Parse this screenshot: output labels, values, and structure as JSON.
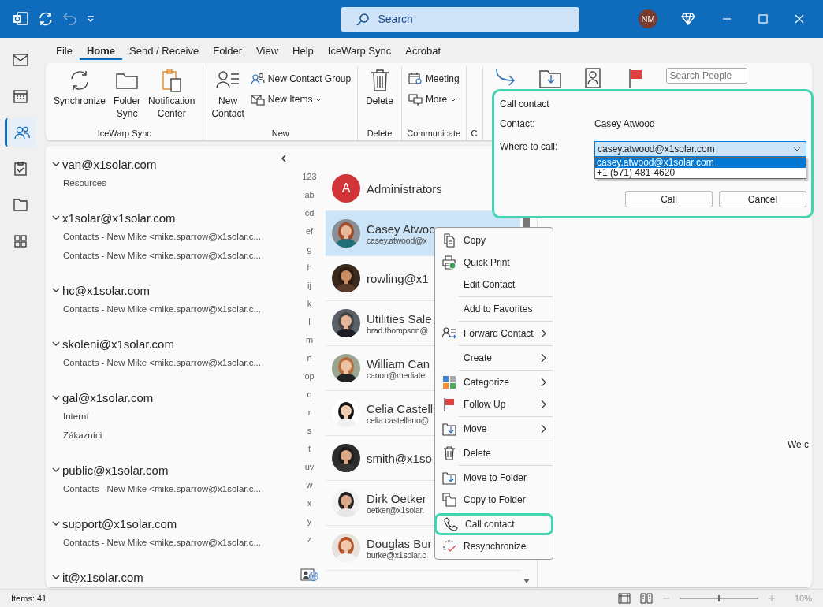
{
  "title_bar": {
    "search": {
      "placeholder": "Search"
    },
    "avatar": "NM",
    "undo": {
      "disabled": true
    }
  },
  "nav_rail": [
    {
      "selected": false
    },
    {
      "selected": false
    },
    {
      "selected": true
    },
    {
      "selected": false
    },
    {
      "selected": false
    },
    {
      "selected": false
    }
  ],
  "ribbon_tabs": [
    {
      "label": "File",
      "selected": false
    },
    {
      "label": "Home",
      "selected": true
    },
    {
      "label": "Send / Receive",
      "selected": false
    },
    {
      "label": "Folder",
      "selected": false
    },
    {
      "label": "View",
      "selected": false
    },
    {
      "label": "Help",
      "selected": false
    },
    {
      "label": "IceWarp Sync",
      "selected": false
    },
    {
      "label": "Acrobat",
      "selected": false
    }
  ],
  "ribbon": {
    "groups": [
      {
        "label": "IceWarp Sync",
        "buttons": [
          {
            "kind": "large",
            "label": "Synchronize"
          },
          {
            "kind": "large",
            "label": "Folder Sync"
          },
          {
            "kind": "large",
            "label": "Notification Center"
          }
        ]
      },
      {
        "label": "New",
        "buttons": [
          {
            "kind": "large",
            "label": "New Contact"
          },
          {
            "kind": "small",
            "label": "New Contact Group",
            "dropdown": false
          },
          {
            "kind": "small",
            "label": "New Items",
            "dropdown": true
          }
        ]
      },
      {
        "label": "Delete",
        "buttons": [
          {
            "kind": "large",
            "label": "Delete"
          }
        ]
      },
      {
        "label": "Communicate",
        "buttons": [
          {
            "kind": "small",
            "label": "Meeting",
            "dropdown": false
          },
          {
            "kind": "small",
            "label": "More",
            "dropdown": true
          }
        ]
      },
      {
        "label": "C"
      }
    ],
    "search_people": {
      "placeholder": "Search People"
    }
  },
  "folders": [
    {
      "name": "van@x1solar.com",
      "expanded": true,
      "children": [
        {
          "name": "Resources"
        }
      ]
    },
    {
      "name": "x1solar@x1solar.com",
      "expanded": true,
      "children": [
        {
          "name": "Contacts - New Mike <mike.sparrow@x1solar.c..."
        },
        {
          "name": "Contacts - New Mike <mike.sparrow@x1solar.c..."
        }
      ]
    },
    {
      "name": "hc@x1solar.com",
      "expanded": true,
      "children": [
        {
          "name": "Contacts - New Mike <mike.sparrow@x1solar.c..."
        }
      ]
    },
    {
      "name": "skoleni@x1solar.com",
      "expanded": true,
      "children": [
        {
          "name": "Contacts - New Mike <mike.sparrow@x1solar.c..."
        }
      ]
    },
    {
      "name": "gal@x1solar.com",
      "expanded": true,
      "children": [
        {
          "name": "Interní"
        },
        {
          "name": "Zákazníci"
        }
      ]
    },
    {
      "name": "public@x1solar.com",
      "expanded": true,
      "children": [
        {
          "name": "Contacts - New Mike <mike.sparrow@x1solar.c..."
        }
      ]
    },
    {
      "name": "support@x1solar.com",
      "expanded": true,
      "children": [
        {
          "name": "Contacts - New Mike <mike.sparrow@x1solar.c..."
        }
      ]
    },
    {
      "name": "it@x1solar.com",
      "expanded": true
    }
  ],
  "alpha_index": [
    "123",
    "ab",
    "cd",
    "ef",
    "g",
    "h",
    "ij",
    "k",
    "l",
    "m",
    "n",
    "op",
    "q",
    "r",
    "s",
    "t",
    "uv",
    "w",
    "x",
    "y",
    "z"
  ],
  "contacts": [
    {
      "kind": "initial",
      "initial": "A",
      "color": "#d13438",
      "name": "Administrators",
      "selected": false
    },
    {
      "name": "Casey Atwoo",
      "email": "casey.atwood@x",
      "selected": true
    },
    {
      "name": "rowling@x1",
      "selected": false
    },
    {
      "name": "Utilities Sale",
      "email": "brad.thompson@",
      "selected": false
    },
    {
      "name": "William Can",
      "email": "canon@mediate",
      "selected": false
    },
    {
      "name": "Celia Castell",
      "email": "celia.castellano@",
      "selected": false
    },
    {
      "name": "smith@x1so",
      "selected": false
    },
    {
      "name": "Dirk Öetker",
      "email": "oetker@x1solar.",
      "selected": false
    },
    {
      "name": "Douglas Bur",
      "email": "burke@x1solar.c",
      "selected": false
    }
  ],
  "context_menu": [
    {
      "label": "Copy",
      "submenu": false,
      "divider_after": false,
      "highlighted": false
    },
    {
      "label": "Quick Print",
      "submenu": false,
      "divider_after": false,
      "highlighted": false
    },
    {
      "label": "Edit Contact",
      "submenu": false,
      "divider_after": true,
      "highlighted": false
    },
    {
      "label": "Add to Favorites",
      "submenu": false,
      "divider_after": true,
      "highlighted": false
    },
    {
      "label": "Forward Contact",
      "submenu": true,
      "divider_after": true,
      "highlighted": false
    },
    {
      "label": "Create",
      "submenu": true,
      "divider_after": true,
      "highlighted": false
    },
    {
      "label": "Categorize",
      "submenu": true,
      "divider_after": false,
      "highlighted": false
    },
    {
      "label": "Follow Up",
      "submenu": true,
      "divider_after": true,
      "highlighted": false
    },
    {
      "label": "Move",
      "submenu": true,
      "divider_after": true,
      "highlighted": false
    },
    {
      "label": "Delete",
      "submenu": false,
      "divider_after": true,
      "highlighted": false
    },
    {
      "label": "Move to Folder",
      "submenu": false,
      "divider_after": false,
      "highlighted": false
    },
    {
      "label": "Copy to Folder",
      "submenu": false,
      "divider_after": true,
      "highlighted": false
    },
    {
      "label": "Call contact",
      "submenu": false,
      "divider_after": false,
      "highlighted": true
    },
    {
      "label": "Resynchronize",
      "submenu": false,
      "divider_after": false,
      "highlighted": false
    }
  ],
  "call_dialog": {
    "title": "Call contact",
    "contact_label": "Contact:",
    "contact": "Casey Atwood",
    "where_label": "Where to call:",
    "value": "casey.atwood@x1solar.com",
    "options": [
      {
        "label": "casey.atwood@x1solar.com",
        "selected": true
      },
      {
        "label": "+1 (571) 481-4620",
        "selected": false
      }
    ],
    "buttons": [
      "Call",
      "Cancel"
    ]
  },
  "reading_pane": {
    "text": "We c"
  },
  "status_bar": {
    "items": "Items: 41",
    "zoom": "10%",
    "zoom_slider": {
      "level": 0.5
    }
  }
}
